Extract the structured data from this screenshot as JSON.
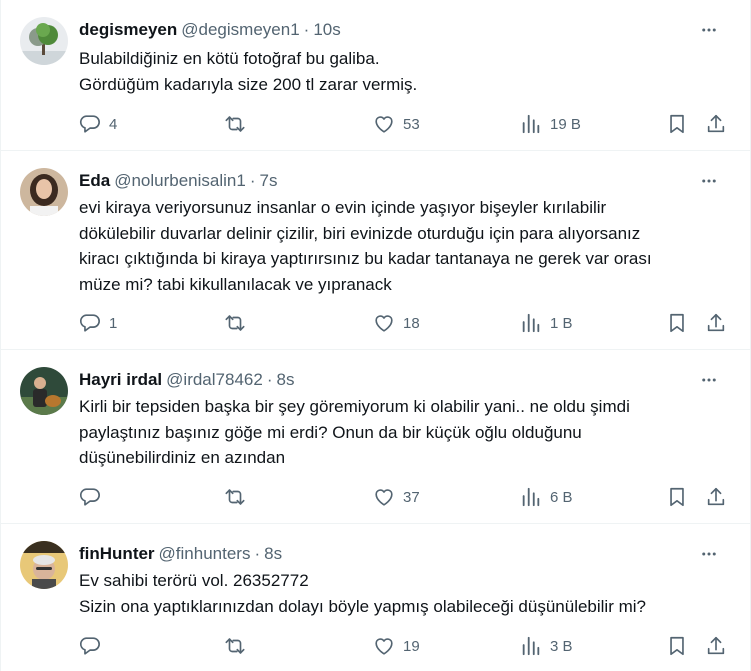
{
  "tweets": [
    {
      "name": "degismeyen",
      "handle": "@degismeyen1",
      "time": "10s",
      "lines": [
        "Bulabildiğiniz en kötü fotoğraf bu galiba.",
        "Gördüğüm kadarıyla size 200 tl zarar vermiş."
      ],
      "replies": "4",
      "retweets": "",
      "likes": "53",
      "views": "19 B"
    },
    {
      "name": "Eda",
      "handle": "@nolurbenisalin1",
      "time": "7s",
      "lines": [
        "evi kiraya veriyorsunuz insanlar o evin içinde yaşıyor bişeyler kırılabilir",
        "dökülebilir duvarlar delinir çizilir, biri evinizde oturduğu için para alıyorsanız",
        "kiracı çıktığında bi kiraya yaptırırsınız bu kadar tantanaya ne gerek var orası",
        "müze mi? tabi kikullanılacak ve yıpranack"
      ],
      "replies": "1",
      "retweets": "",
      "likes": "18",
      "views": "1 B"
    },
    {
      "name": "Hayri irdal",
      "handle": "@irdal78462",
      "time": "8s",
      "lines": [
        "Kirli bir tepsiden başka bir şey göremiyorum ki olabilir yani.. ne oldu şimdi",
        "paylaştınız başınız göğe mi erdi? Onun da bir küçük oğlu olduğunu",
        "düşünebilirdiniz en azından"
      ],
      "replies": "",
      "retweets": "",
      "likes": "37",
      "views": "6 B"
    },
    {
      "name": "finHunter",
      "handle": "@finhunters",
      "time": "8s",
      "lines": [
        "Ev sahibi terörü vol. 26352772",
        "Sizin ona yaptıklarınızdan dolayı böyle yapmış olabileceği düşünülebilir mi?"
      ],
      "replies": "",
      "retweets": "",
      "likes": "19",
      "views": "3 B"
    }
  ],
  "icons": {
    "reply": "reply-icon",
    "retweet": "retweet-icon",
    "like": "heart-icon",
    "views": "views-icon",
    "bookmark": "bookmark-icon",
    "share": "share-icon",
    "more": "more-icon"
  },
  "colors": {
    "text": "#0f1419",
    "secondary": "#536471",
    "border": "#eff3f4"
  }
}
